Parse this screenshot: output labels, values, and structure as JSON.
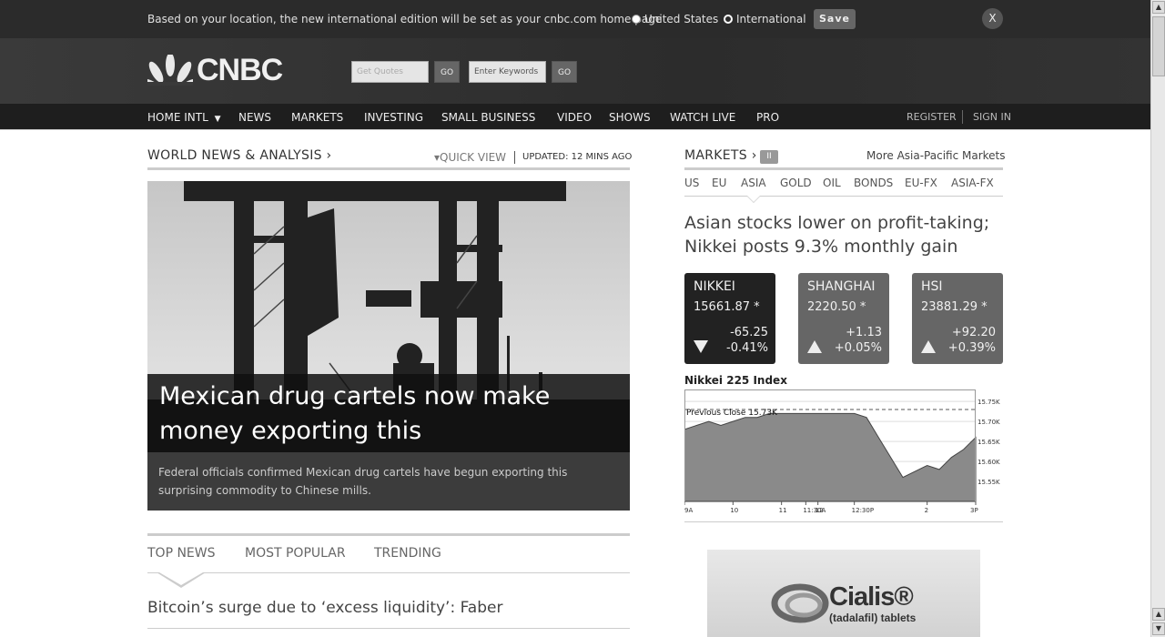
{
  "notice": {
    "message": "Based on your location, the new international edition will be set as your cnbc.com home page",
    "options": [
      "United States",
      "International"
    ],
    "selected": "International",
    "save_label": "Save",
    "close_label": "X"
  },
  "header": {
    "logo_text": "CNBC",
    "quote_placeholder": "Get Quotes",
    "quote_go": "GO",
    "keywords_placeholder": "Enter Keywords",
    "keywords_go": "GO"
  },
  "nav": {
    "items": [
      "HOME INTL",
      "NEWS",
      "MARKETS",
      "INVESTING",
      "SMALL BUSINESS",
      "VIDEO",
      "SHOWS",
      "WATCH LIVE",
      "PRO"
    ],
    "home_caret": "▼",
    "register": "REGISTER",
    "sign_in": "SIGN IN"
  },
  "world_news": {
    "heading": "WORLD NEWS & ANALYSIS ›",
    "quick_view": "▾QUICK VIEW",
    "updated": "UPDATED: 12 MINS AGO",
    "hero": {
      "title": "Mexican drug cartels now make money exporting this",
      "description": "Federal officials confirmed Mexican drug cartels have begun exporting this surprising commodity to Chinese mills."
    }
  },
  "news_tabs": {
    "tabs": [
      "TOP NEWS",
      "MOST POPULAR",
      "TRENDING"
    ],
    "active": "TOP NEWS",
    "top_story": "Bitcoin’s surge due to ‘excess liquidity’: Faber"
  },
  "markets": {
    "heading": "MARKETS ›",
    "pause_label": "II",
    "more_link": "More Asia-Pacific Markets",
    "tabs": [
      "US",
      "EU",
      "ASIA",
      "GOLD",
      "OIL",
      "BONDS",
      "EU-FX",
      "ASIA-FX"
    ],
    "active_tab": "ASIA",
    "headline": "Asian stocks lower on profit-taking; Nikkei posts 9.3% monthly gain",
    "indices": [
      {
        "name": "NIKKEI",
        "price": "15661.87 *",
        "change": "-65.25",
        "percent": "-0.41%",
        "direction": "down"
      },
      {
        "name": "SHANGHAI",
        "price": "2220.50 *",
        "change": "+1.13",
        "percent": "+0.05%",
        "direction": "up"
      },
      {
        "name": "HSI",
        "price": "23881.29 *",
        "change": "+92.20",
        "percent": "+0.39%",
        "direction": "up"
      }
    ]
  },
  "chart_data": {
    "type": "area",
    "title": "Nikkei 225 Index",
    "annotation": "Previous Close 15.73K",
    "previous_close": 15.73,
    "x_tick_labels": [
      "9A",
      "10",
      "11",
      "11:30A",
      "12",
      "12:30P",
      "2",
      "3P"
    ],
    "y_tick_labels": [
      "15.75K",
      "15.70K",
      "15.65K",
      "15.60K",
      "15.55K"
    ],
    "y_ticks": [
      15.75,
      15.7,
      15.65,
      15.6,
      15.55
    ],
    "ylim": [
      15.5,
      15.78
    ],
    "x_hours": [
      9,
      9.25,
      9.5,
      9.75,
      10,
      10.25,
      10.5,
      10.75,
      11,
      11.25,
      11.5,
      12.5,
      12.75,
      13,
      13.5,
      14,
      14.25,
      14.5,
      14.75,
      15
    ],
    "values": [
      15.68,
      15.69,
      15.7,
      15.69,
      15.7,
      15.71,
      15.71,
      15.72,
      15.72,
      15.72,
      15.72,
      15.72,
      15.71,
      15.66,
      15.56,
      15.59,
      15.58,
      15.61,
      15.63,
      15.66
    ],
    "grid": true
  },
  "ad": {
    "brand": "Cialis®",
    "sub": "(tadalafil) tablets"
  },
  "colors": {
    "notice_bg": "#2b2b2b",
    "nav_bg": "#1e1e1e",
    "tile_dark": "#222222",
    "tile_mid": "#666666"
  }
}
